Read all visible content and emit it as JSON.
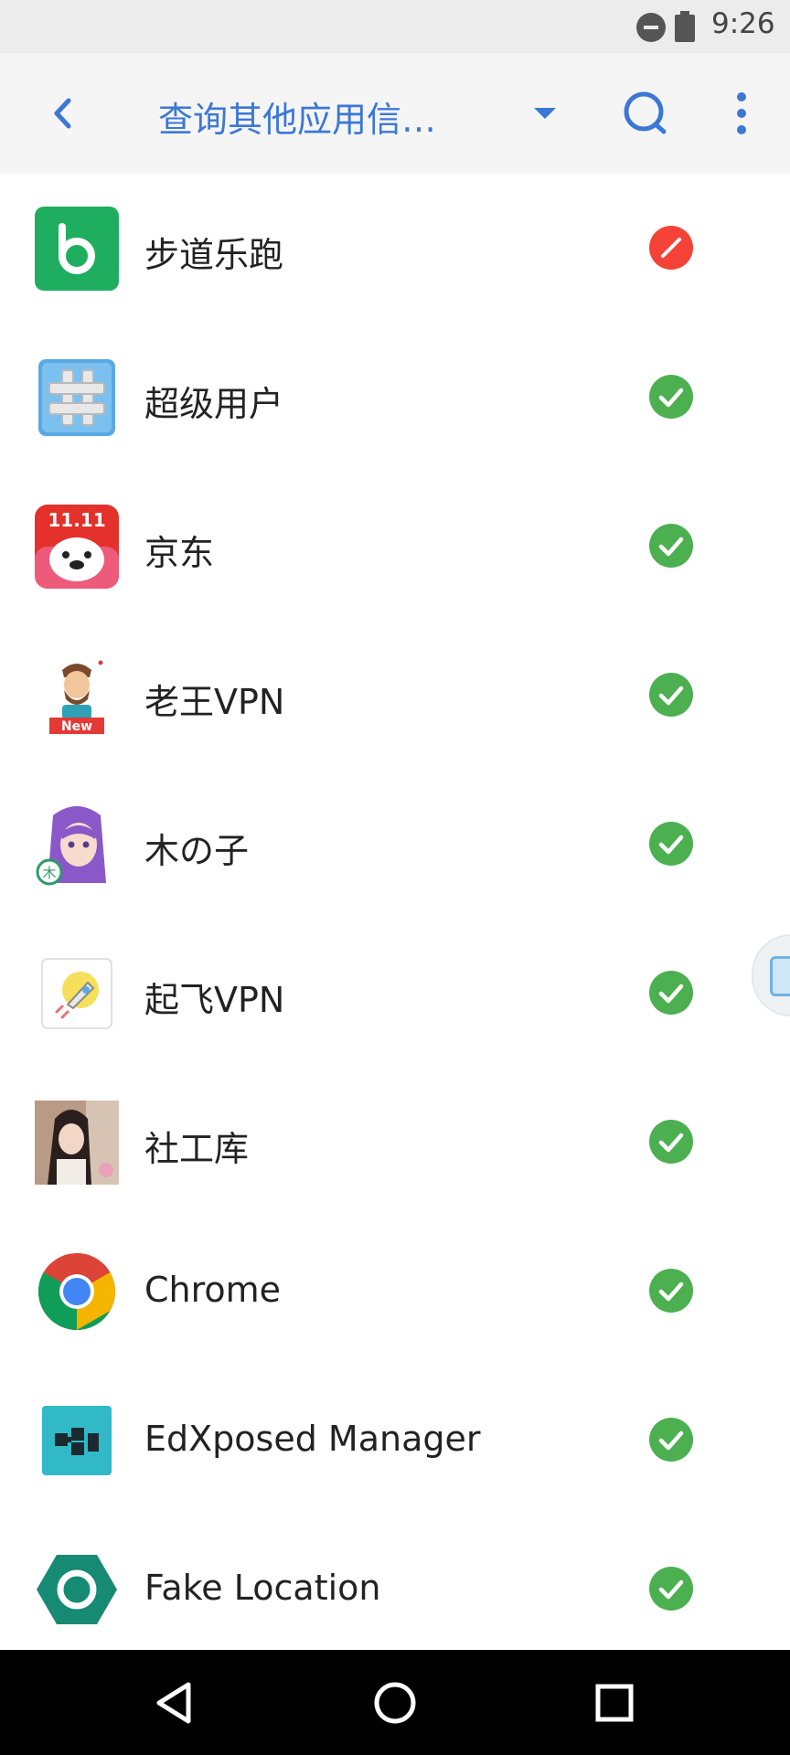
{
  "status_bar": {
    "time": "9:26"
  },
  "toolbar": {
    "title": "查询其他应用信…"
  },
  "apps": [
    {
      "label": "步道乐跑",
      "status": "blocked"
    },
    {
      "label": "超级用户",
      "status": "allowed"
    },
    {
      "label": "京东",
      "status": "allowed"
    },
    {
      "label": "老王VPN",
      "status": "allowed"
    },
    {
      "label": "木の子",
      "status": "allowed"
    },
    {
      "label": "起飞VPN",
      "status": "allowed"
    },
    {
      "label": "社工库",
      "status": "allowed"
    },
    {
      "label": "Chrome",
      "status": "allowed"
    },
    {
      "label": "EdXposed Manager",
      "status": "allowed"
    },
    {
      "label": "Fake Location",
      "status": "allowed"
    }
  ],
  "app_icon_badges": {
    "laowang_vpn": "New",
    "mu_no_zi": "木",
    "jd": "11.11"
  },
  "colors": {
    "accent": "#3b78d6",
    "allowed": "#4caf50",
    "blocked": "#f44336",
    "toolbar_bg": "#f5f5f5",
    "status_bar_bg": "#ececec"
  },
  "icons": {
    "back": "chevron-left-icon",
    "dropdown": "caret-down-icon",
    "search": "search-icon",
    "more": "more-vert-icon",
    "allowed": "check-circle-icon",
    "blocked": "blocked-circle-icon"
  }
}
